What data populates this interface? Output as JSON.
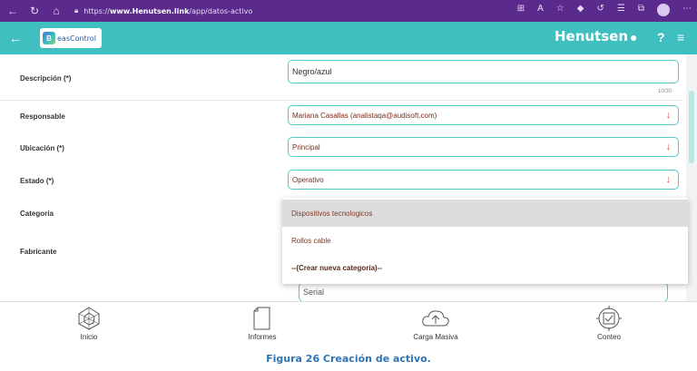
{
  "browser": {
    "url_prefix": "https://",
    "url_domain": "www.Henutsen.link",
    "url_path": "/app/datos-activo"
  },
  "header": {
    "logo_letter": "B",
    "logo_text": "easControl",
    "brand": "Henutsen"
  },
  "form": {
    "descripcion": {
      "label": "Descripción (*)",
      "value": "Negro/azul",
      "counter": "10/30"
    },
    "responsable": {
      "label": "Responsable",
      "value": "Mariana Casallas (analistaqa@audisoft.com)"
    },
    "ubicacion": {
      "label": "Ubicación (*)",
      "value": "Principal"
    },
    "estado": {
      "label": "Estado (*)",
      "value": "Operativo"
    },
    "categoria": {
      "label": "Categoría"
    },
    "fabricante": {
      "label": "Fabricante"
    },
    "serial": {
      "placeholder": "Serial"
    }
  },
  "dropdown": {
    "options": [
      "Dispositivos tecnologicos",
      "Rollos cable",
      "--(Crear nueva categoría)--"
    ]
  },
  "bottom_nav": {
    "inicio": "Inicio",
    "informes": "Informes",
    "carga_masiva": "Carga Masiva",
    "conteo": "Conteo"
  },
  "caption": "Figura 26 Creación de activo.",
  "colors": {
    "teal": "#3fbfbf",
    "browser": "#5a2a8c",
    "arrow_red": "#d64c3c",
    "caption_blue": "#2e74b5"
  }
}
